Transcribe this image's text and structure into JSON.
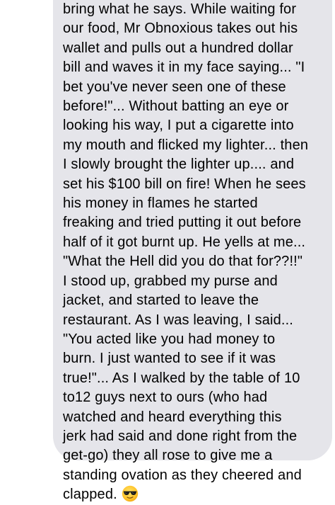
{
  "message": {
    "lines": [
      "bring what he says. While waiting for",
      "our food, Mr Obnoxious takes out his",
      "wallet and pulls out a hundred dollar",
      "bill and waves it in my face saying... \"I",
      "bet you've never seen one of these",
      "before!\"... Without batting an eye or",
      "looking his way, I put a cigarette into",
      "my mouth and flicked my lighter... then",
      "I slowly brought the lighter up.... and",
      "set his $100 bill on fire! When he sees",
      "his money in flames he started",
      "freaking and tried putting it out before",
      "half of it got burnt up. He yells at me...",
      "\"What the Hell did you do that for??!!\"",
      "I stood up, grabbed my purse and",
      "jacket, and started to leave the",
      "restaurant. As I was leaving, I said...",
      "\"You acted like you had money to",
      "burn. I just wanted to see if it was",
      "true!\"... As I walked by the table of 10",
      "to12 guys next to ours (who had",
      "watched and heard everything this",
      "jerk had said and done right from the",
      "get-go) they all rose to give me a",
      "standing ovation as they cheered and",
      "clapped."
    ],
    "emoji": "smiling-face-with-sunglasses-icon"
  },
  "colors": {
    "bubble": "#e5e5ea",
    "text": "#000000",
    "background": "#ffffff"
  }
}
